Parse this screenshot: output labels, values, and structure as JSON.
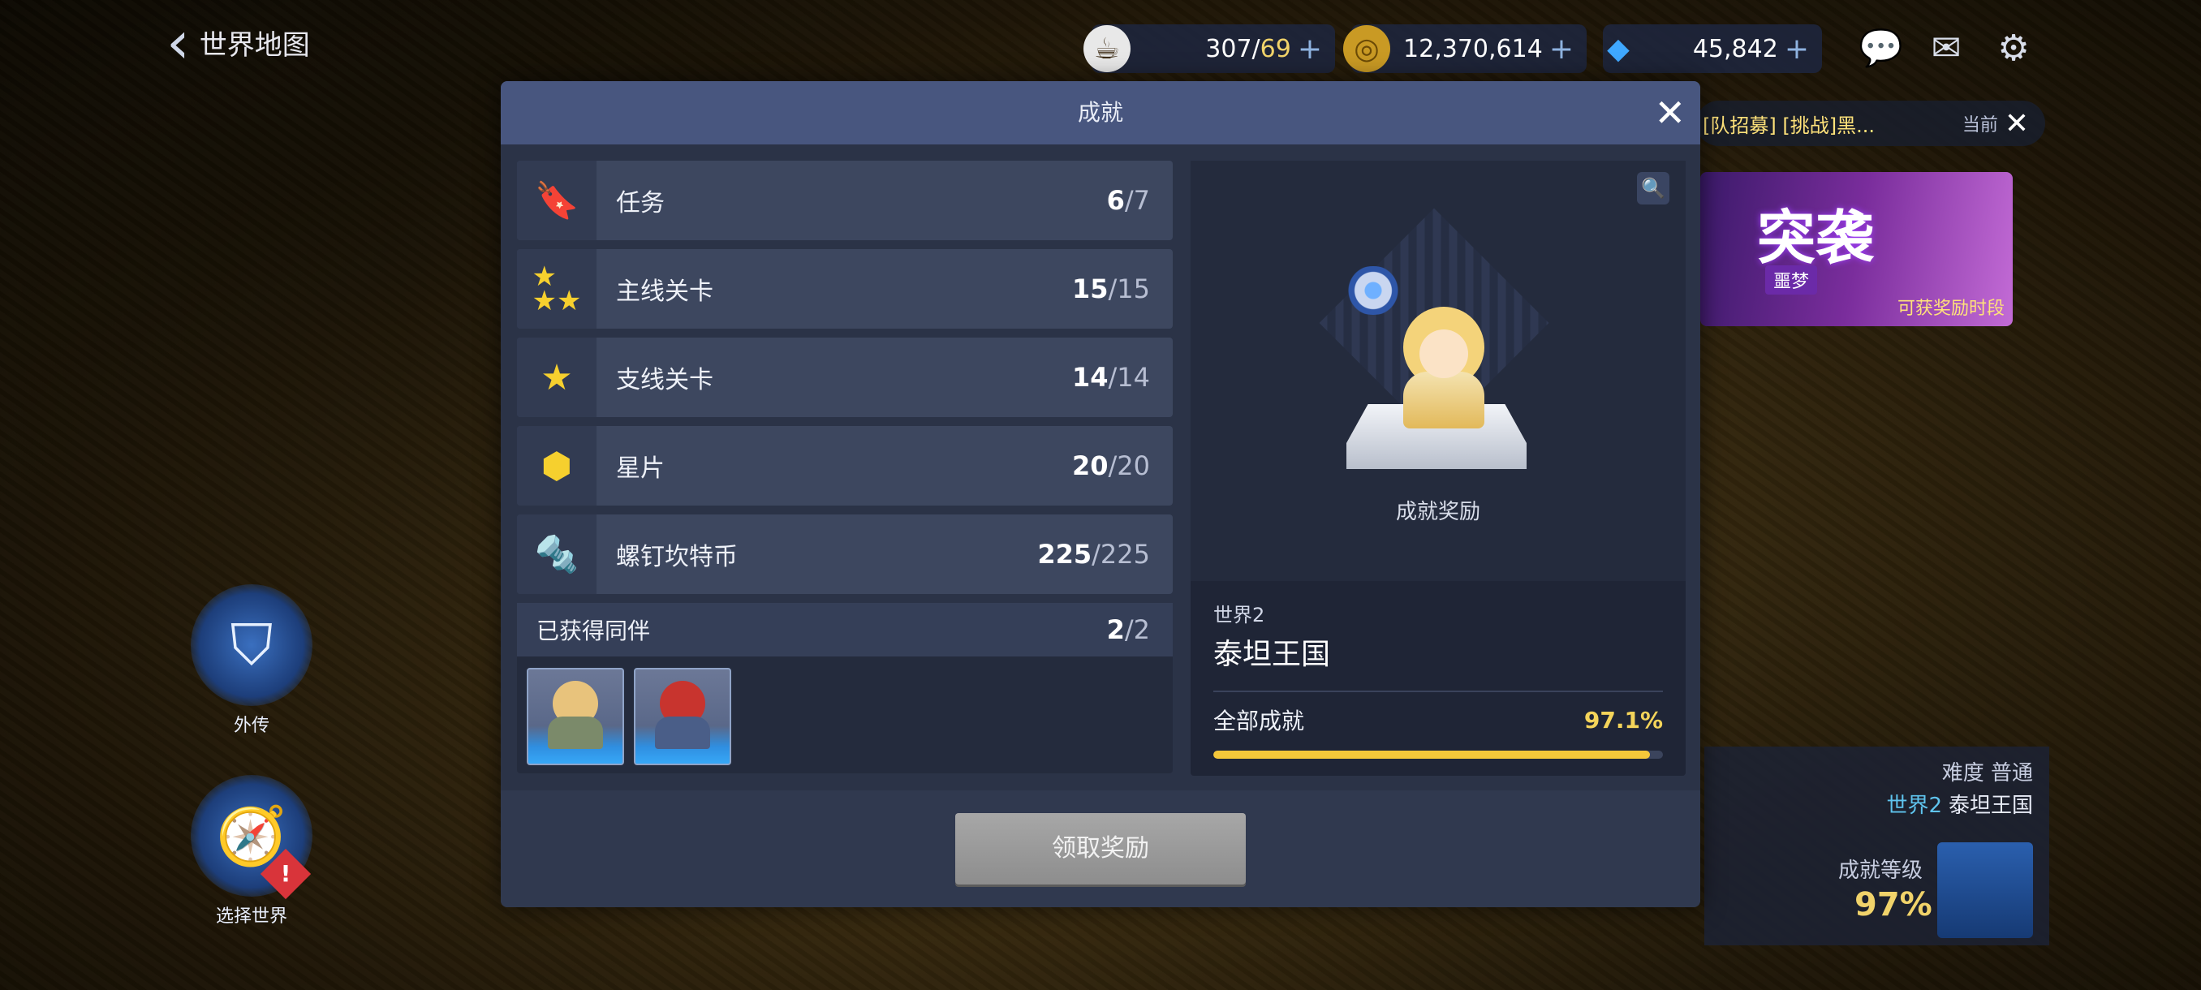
{
  "header": {
    "back_title": "世界地图",
    "resources": [
      {
        "name": "stamina",
        "icon": "coffee-cup-icon",
        "value": "307",
        "max": "69"
      },
      {
        "name": "gold",
        "icon": "gold-coin-icon",
        "value": "12,370,614"
      },
      {
        "name": "gems",
        "icon": "blue-gem-icon",
        "value": "45,842"
      }
    ],
    "slash": "/",
    "plus": "+"
  },
  "notice": {
    "text": "[队招募] [挑战]黑...",
    "current": "当前"
  },
  "banner": {
    "title": "突袭",
    "subtitle": "噩梦",
    "caption": "可获奖励时段"
  },
  "side": {
    "side_story": "外传",
    "select_world": "选择世界"
  },
  "info_panel": {
    "difficulty": "难度  普通",
    "world": "世界2",
    "world_name": "泰坦王国",
    "level_label": "成就等级",
    "level_value": "97%"
  },
  "modal": {
    "title": "成就",
    "rows": [
      {
        "label": "任务",
        "got": "6",
        "total": "7",
        "icon": "bookmark-icon"
      },
      {
        "label": "主线关卡",
        "got": "15",
        "total": "15",
        "icon": "three-stars-icon"
      },
      {
        "label": "支线关卡",
        "got": "14",
        "total": "14",
        "icon": "star-icon"
      },
      {
        "label": "星片",
        "got": "20",
        "total": "20",
        "icon": "star-piece-icon"
      },
      {
        "label": "螺钉坎特币",
        "got": "225",
        "total": "225",
        "icon": "screw-coin-icon"
      }
    ],
    "companions": {
      "label": "已获得同伴",
      "got": "2",
      "total": "2"
    },
    "showcase_label": "成就奖励",
    "world_number": "世界2",
    "world_name": "泰坦王国",
    "total_label": "全部成就",
    "total_percent": "97.1%",
    "total_fraction": 0.971,
    "claim_button": "领取奖励"
  },
  "colors": {
    "accent_yellow": "#f4c73a",
    "panel": "#2b3347",
    "header": "#48567f"
  }
}
